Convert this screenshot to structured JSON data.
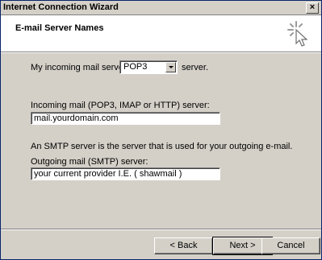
{
  "window": {
    "title": "Internet Connection Wizard",
    "close_glyph": "×"
  },
  "header": {
    "title": "E-mail Server Names",
    "icon": "wizard-sparkle-cursor-icon"
  },
  "incoming_type": {
    "label": "My incoming mail server is a",
    "selected": "POP3",
    "suffix": "server."
  },
  "incoming_server": {
    "label": "Incoming mail (POP3, IMAP or HTTP) server:",
    "value": "mail.yourdomain.com"
  },
  "smtp_note": "An SMTP server is the server that is used for your outgoing e-mail.",
  "outgoing_server": {
    "label": "Outgoing mail (SMTP) server:",
    "value": "your current provider I.E. ( shawmail )"
  },
  "buttons": {
    "back": "< Back",
    "next": "Next >",
    "cancel": "Cancel"
  }
}
